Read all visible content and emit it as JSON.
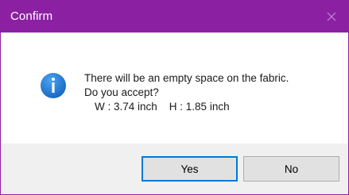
{
  "window": {
    "title": "Confirm",
    "close_icon": "close-icon",
    "accent_color": "#8b21a2"
  },
  "message": {
    "icon": "info-icon",
    "line1": "There will be an empty space on the fabric.",
    "line2": "Do you accept?",
    "dimensions": "W : 3.74 inch    H : 1.85 inch"
  },
  "buttons": {
    "yes_label": "Yes",
    "no_label": "No"
  }
}
